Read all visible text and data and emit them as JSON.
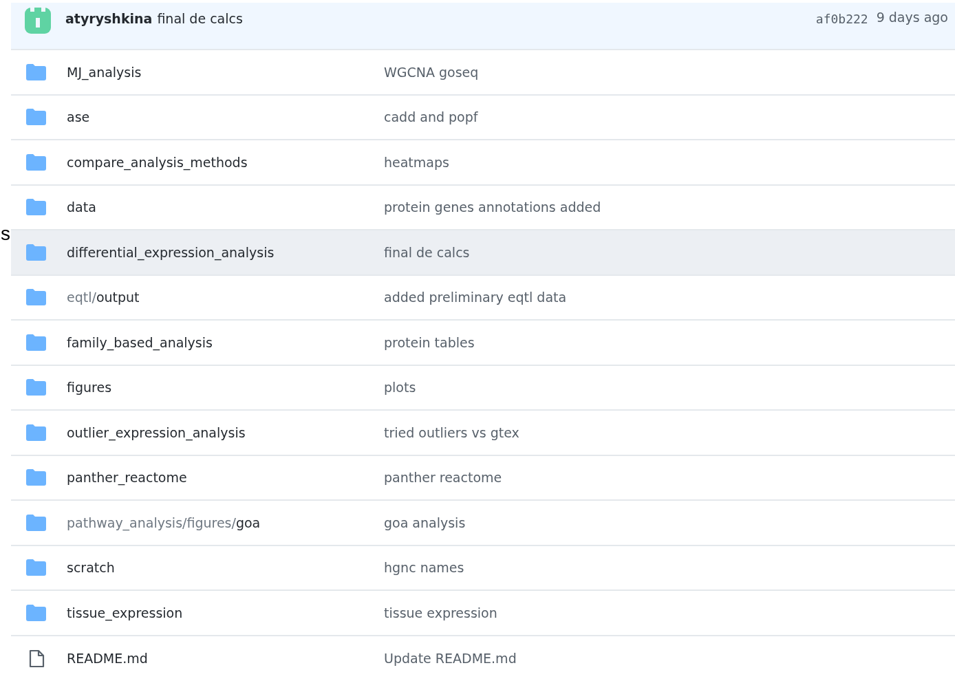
{
  "edge_text": "s",
  "latest_commit": {
    "author": "atyryshkina",
    "message": "final de calcs",
    "hash": "af0b222",
    "time": "9 days ago"
  },
  "files": [
    {
      "kind": "folder",
      "name": "MJ_analysis",
      "message": "WGCNA goseq",
      "highlighted": false
    },
    {
      "kind": "folder",
      "name": "ase",
      "message": "cadd and popf",
      "highlighted": false
    },
    {
      "kind": "folder",
      "name": "compare_analysis_methods",
      "message": "heatmaps",
      "highlighted": false
    },
    {
      "kind": "folder",
      "name": "data",
      "message": "protein genes annotations added",
      "highlighted": false
    },
    {
      "kind": "folder",
      "name": "differential_expression_analysis",
      "message": "final de calcs",
      "highlighted": true
    },
    {
      "kind": "folder",
      "path_prefix": "eqtl/",
      "name": "output",
      "message": "added preliminary eqtl data",
      "highlighted": false
    },
    {
      "kind": "folder",
      "name": "family_based_analysis",
      "message": "protein tables",
      "highlighted": false
    },
    {
      "kind": "folder",
      "name": "figures",
      "message": "plots",
      "highlighted": false
    },
    {
      "kind": "folder",
      "name": "outlier_expression_analysis",
      "message": "tried outliers vs gtex",
      "highlighted": false
    },
    {
      "kind": "folder",
      "name": "panther_reactome",
      "message": "panther reactome",
      "highlighted": false
    },
    {
      "kind": "folder",
      "path_prefix": "pathway_analysis/figures/",
      "name": "goa",
      "message": "goa analysis",
      "highlighted": false
    },
    {
      "kind": "folder",
      "name": "scratch",
      "message": "hgnc names",
      "highlighted": false
    },
    {
      "kind": "folder",
      "name": "tissue_expression",
      "message": "tissue expression",
      "highlighted": false
    },
    {
      "kind": "file",
      "name": "README.md",
      "message": "Update README.md",
      "highlighted": false
    }
  ]
}
